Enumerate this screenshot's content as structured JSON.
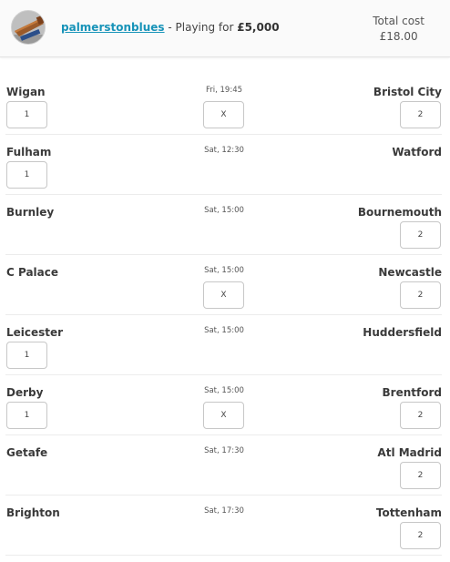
{
  "header": {
    "username": "palmerstonblues",
    "playing_text": " - Playing for ",
    "amount": "£5,000",
    "total_cost_label": "Total cost",
    "total_cost_value": "£18.00"
  },
  "matches": [
    {
      "home": "Wigan",
      "away": "Bristol City",
      "time": "Fri, 19:45",
      "home_pick": "1",
      "draw_pick": "X",
      "away_pick": "2"
    },
    {
      "home": "Fulham",
      "away": "Watford",
      "time": "Sat, 12:30",
      "home_pick": "1",
      "draw_pick": "",
      "away_pick": ""
    },
    {
      "home": "Burnley",
      "away": "Bournemouth",
      "time": "Sat, 15:00",
      "home_pick": "",
      "draw_pick": "",
      "away_pick": "2"
    },
    {
      "home": "C Palace",
      "away": "Newcastle",
      "time": "Sat, 15:00",
      "home_pick": "",
      "draw_pick": "X",
      "away_pick": "2"
    },
    {
      "home": "Leicester",
      "away": "Huddersfield",
      "time": "Sat, 15:00",
      "home_pick": "1",
      "draw_pick": "",
      "away_pick": ""
    },
    {
      "home": "Derby",
      "away": "Brentford",
      "time": "Sat, 15:00",
      "home_pick": "1",
      "draw_pick": "X",
      "away_pick": "2"
    },
    {
      "home": "Getafe",
      "away": "Atl Madrid",
      "time": "Sat, 17:30",
      "home_pick": "",
      "draw_pick": "",
      "away_pick": "2"
    },
    {
      "home": "Brighton",
      "away": "Tottenham",
      "time": "Sat, 17:30",
      "home_pick": "",
      "draw_pick": "",
      "away_pick": "2"
    }
  ]
}
